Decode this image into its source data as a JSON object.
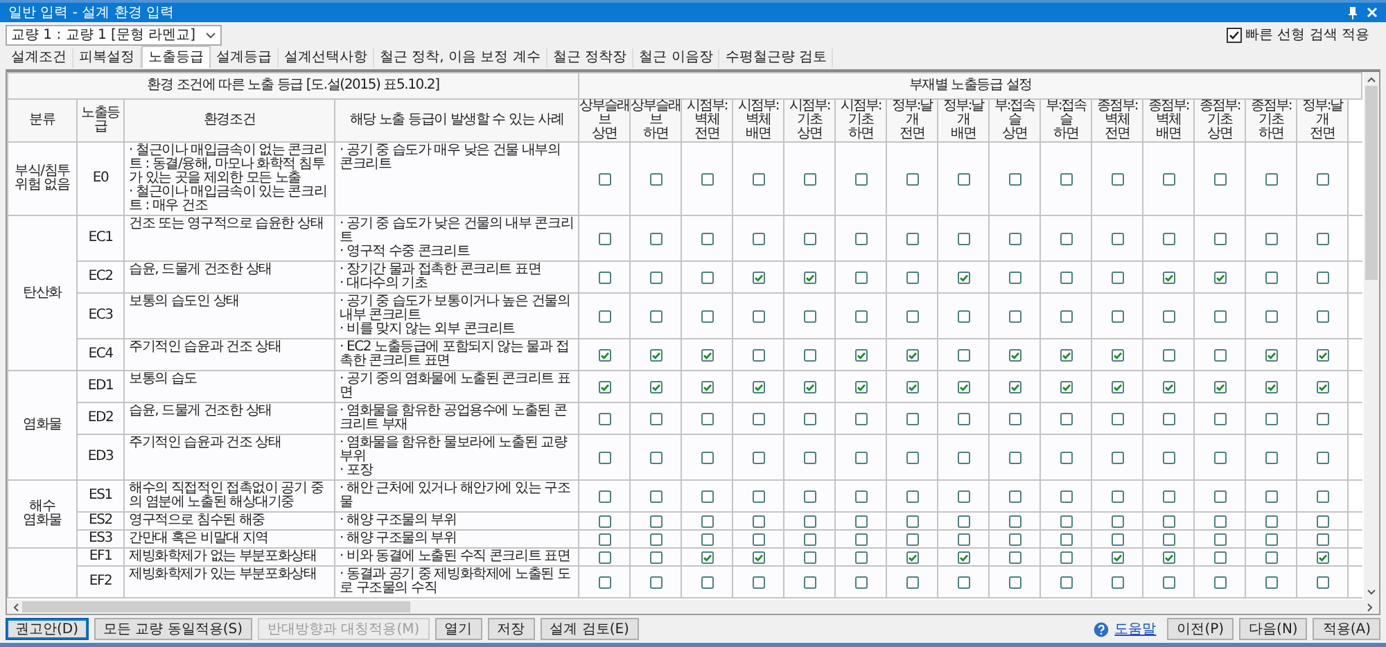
{
  "window": {
    "title": "일반 입력 - 설계 환경 입력"
  },
  "bridge_select": {
    "value": "교량 1 : 교량 1 [문형 라멘교]"
  },
  "quick_search": {
    "label": "빠른 선형 검색 적용",
    "checked": true
  },
  "tabs": [
    {
      "label": "설계조건",
      "selected": false
    },
    {
      "label": "피복설정",
      "selected": false
    },
    {
      "label": "노출등급",
      "selected": true
    },
    {
      "label": "설계등급",
      "selected": false
    },
    {
      "label": "설계선택사항",
      "selected": false
    },
    {
      "label": "철근 정착, 이음 보정 계수",
      "selected": false
    },
    {
      "label": "철근 정착장",
      "selected": false
    },
    {
      "label": "철근 이음장",
      "selected": false
    },
    {
      "label": "수평철근량 검토",
      "selected": false
    }
  ],
  "table": {
    "left_title": "환경 조건에 따른 노출 등급 [도.설(2015) 표5.10.2]",
    "right_title": "부재별 노출등급 설정",
    "columns": [
      "분류",
      "노출등급",
      "환경조건",
      "해당 노출 등급이 발생할 수 있는 사례"
    ],
    "members": [
      {
        "name": "상부슬래브",
        "face": "상면"
      },
      {
        "name": "상부슬래브",
        "face": "하면"
      },
      {
        "name": "시점부:벽체",
        "face": "전면"
      },
      {
        "name": "시점부:벽체",
        "face": "배면"
      },
      {
        "name": "시점부:기초",
        "face": "상면"
      },
      {
        "name": "시점부:기초",
        "face": "하면"
      },
      {
        "name": "정부:날개",
        "face": "전면"
      },
      {
        "name": "정부:날개",
        "face": "배면"
      },
      {
        "name": "부:접속슬",
        "face": "상면"
      },
      {
        "name": "부:접속슬",
        "face": "하면"
      },
      {
        "name": "종점부:벽체",
        "face": "전면"
      },
      {
        "name": "종점부:벽체",
        "face": "배면"
      },
      {
        "name": "종점부:기초",
        "face": "상면"
      },
      {
        "name": "종점부:기초",
        "face": "하면"
      },
      {
        "name": "정부:날개",
        "face": "전면"
      }
    ],
    "groups": [
      {
        "category": "부식/침투\n위험 없음",
        "rows": [
          {
            "grade": "E0",
            "conditions": [
              "· 철근이나 매입금속이 없는 콘크리트 : 동결/융해, 마모나 화학적 침투가 있는 곳을 제외한 모든 노출",
              "· 철근이나 매입금속이 있는 콘크리트 : 매우 건조"
            ],
            "examples": [
              "· 공기 중 습도가 매우 낮은 건물 내부의 콘크리트"
            ],
            "checks": [
              false,
              false,
              false,
              false,
              false,
              false,
              false,
              false,
              false,
              false,
              false,
              false,
              false,
              false,
              false
            ]
          }
        ]
      },
      {
        "category": "탄산화",
        "rows": [
          {
            "grade": "EC1",
            "conditions": [
              "건조 또는 영구적으로 습윤한 상태"
            ],
            "examples": [
              "· 공기 중 습도가 낮은 건물의 내부 콘크리트",
              "· 영구적 수중 콘크리트"
            ],
            "checks": [
              false,
              false,
              false,
              false,
              false,
              false,
              false,
              false,
              false,
              false,
              false,
              false,
              false,
              false,
              false
            ]
          },
          {
            "grade": "EC2",
            "conditions": [
              "습윤, 드물게 건조한 상태"
            ],
            "examples": [
              "· 장기간 물과 접촉한 콘크리트 표면",
              "· 대다수의 기초"
            ],
            "checks": [
              false,
              false,
              false,
              true,
              true,
              false,
              false,
              true,
              false,
              false,
              false,
              true,
              true,
              false,
              false
            ]
          },
          {
            "grade": "EC3",
            "conditions": [
              "보통의 습도인 상태"
            ],
            "examples": [
              "· 공기 중 습도가 보통이거나 높은 건물의 내부 콘크리트",
              "· 비를 맞지 않는 외부 콘크리트"
            ],
            "checks": [
              false,
              false,
              false,
              false,
              false,
              false,
              false,
              false,
              false,
              false,
              false,
              false,
              false,
              false,
              false
            ]
          },
          {
            "grade": "EC4",
            "conditions": [
              "주기적인 습윤과 건조 상태"
            ],
            "examples": [
              "· EC2 노출등급에 포함되지 않는 물과 접촉한 콘크리트 표면"
            ],
            "checks": [
              true,
              true,
              true,
              false,
              false,
              true,
              true,
              false,
              true,
              true,
              true,
              false,
              false,
              true,
              true
            ]
          }
        ]
      },
      {
        "category": "염화물",
        "rows": [
          {
            "grade": "ED1",
            "conditions": [
              "보통의 습도"
            ],
            "examples": [
              "· 공기 중의 염화물에 노출된 콘크리트 표면"
            ],
            "checks": [
              true,
              true,
              true,
              true,
              true,
              true,
              true,
              true,
              true,
              true,
              true,
              true,
              true,
              true,
              true
            ]
          },
          {
            "grade": "ED2",
            "conditions": [
              "습윤, 드물게 건조한 상태"
            ],
            "examples": [
              "· 염화물을 함유한 공업용수에 노출된 콘크리트 부재"
            ],
            "checks": [
              false,
              false,
              false,
              false,
              false,
              false,
              false,
              false,
              false,
              false,
              false,
              false,
              false,
              false,
              false
            ]
          },
          {
            "grade": "ED3",
            "conditions": [
              "주기적인 습윤과 건조 상태"
            ],
            "examples": [
              "· 염화물을 함유한 물보라에 노출된 교량 부위",
              "· 포장"
            ],
            "checks": [
              false,
              false,
              false,
              false,
              false,
              false,
              false,
              false,
              false,
              false,
              false,
              false,
              false,
              false,
              false
            ]
          }
        ]
      },
      {
        "category": "해수\n염화물",
        "rows": [
          {
            "grade": "ES1",
            "conditions": [
              "해수의 직접적인 접촉없이 공기 중의 염분에 노출된 해상대기중"
            ],
            "examples": [
              "· 해안 근처에 있거나 해안가에 있는 구조물"
            ],
            "checks": [
              false,
              false,
              false,
              false,
              false,
              false,
              false,
              false,
              false,
              false,
              false,
              false,
              false,
              false,
              false
            ]
          },
          {
            "grade": "ES2",
            "conditions": [
              "영구적으로 침수된 해중"
            ],
            "examples": [
              "· 해양 구조물의 부위"
            ],
            "checks": [
              false,
              false,
              false,
              false,
              false,
              false,
              false,
              false,
              false,
              false,
              false,
              false,
              false,
              false,
              false
            ]
          },
          {
            "grade": "ES3",
            "conditions": [
              "간만대 혹은 비말대 지역"
            ],
            "examples": [
              "· 해양 구조물의 부위"
            ],
            "checks": [
              false,
              false,
              false,
              false,
              false,
              false,
              false,
              false,
              false,
              false,
              false,
              false,
              false,
              false,
              false
            ]
          }
        ]
      },
      {
        "rows": [
          {
            "grade": "EF1",
            "conditions": [
              "제빙화학제가 없는 부분포화상태"
            ],
            "examples": [
              "· 비와 동결에 노출된 수직 콘크리트 표면"
            ],
            "checks": [
              false,
              false,
              true,
              true,
              false,
              false,
              true,
              true,
              false,
              false,
              true,
              true,
              false,
              false,
              true
            ]
          },
          {
            "grade": "EF2",
            "conditions": [
              "제빙화학제가 있는 부분포화상태"
            ],
            "examples": [
              "· 동결과 공기 중 제빙화학제에 노출된 도로 구조물의 수직"
            ],
            "checks": [
              false,
              false,
              false,
              false,
              false,
              false,
              false,
              false,
              false,
              false,
              false,
              false,
              false,
              false,
              false
            ]
          }
        ]
      }
    ]
  },
  "left_buttons": [
    {
      "label": "권고안(D)",
      "disabled": false
    },
    {
      "label": "모든 교량 동일적용(S)",
      "disabled": false
    },
    {
      "label": "반대방향과 대칭적용(M)",
      "disabled": true
    },
    {
      "label": "열기",
      "disabled": false
    },
    {
      "label": "저장",
      "disabled": false
    },
    {
      "label": "설계 검토(E)",
      "disabled": false
    }
  ],
  "help_link": "도움말",
  "right_buttons": [
    {
      "label": "이전(P)",
      "disabled": false
    },
    {
      "label": "다음(N)",
      "disabled": false
    },
    {
      "label": "적용(A)",
      "disabled": false
    }
  ]
}
